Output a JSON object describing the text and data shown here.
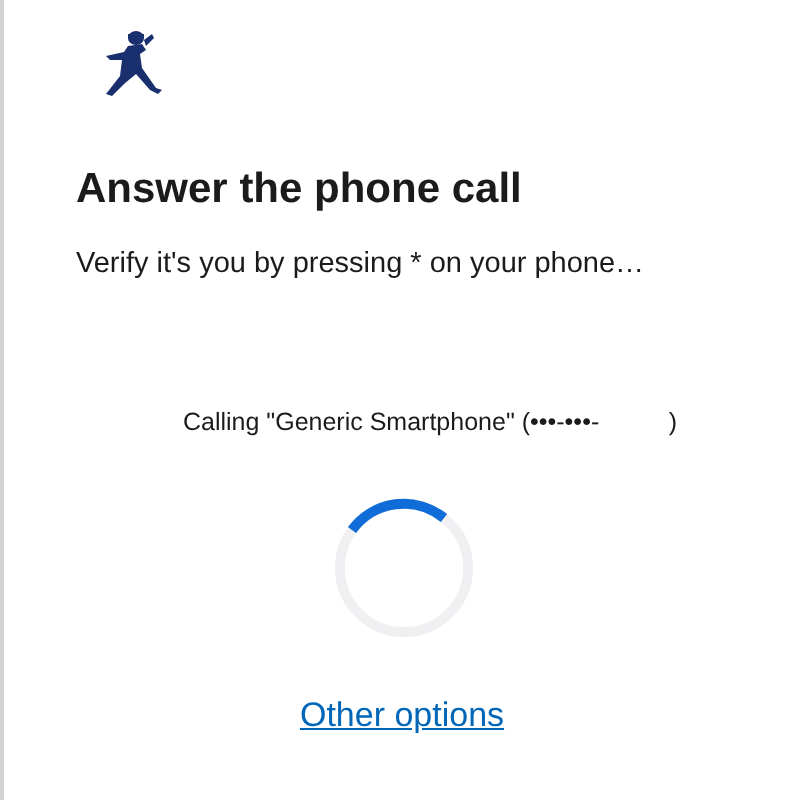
{
  "title": "Answer the phone call",
  "description": "Verify it's you by pressing * on your phone…",
  "calling_text": "Calling \"Generic Smartphone\" (•••-•••-          )",
  "link": "Other options"
}
